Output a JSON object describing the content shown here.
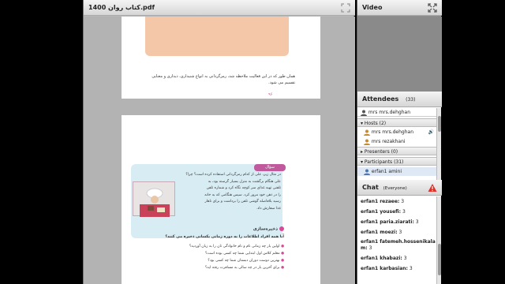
{
  "document_pod": {
    "title": "کتاب روان 1400.pdf",
    "page1": {
      "text_lines": [
        "همان طور که در این فعالیت ملاحظه شد، رمزگردانی به انواع شنیداری، دیداری و معنایی",
        "تقسیم می شود."
      ],
      "page_number": "۹۶"
    },
    "page2": {
      "question_badge": "سؤال",
      "question_lines": [
        "در مثال زیر، علی از کدام رمزگردانی استفاده کرده است؟ چرا؟",
        "علی هنگام برگشت به منزل بسیار گرسنه بود، به",
        "تلفنی تهیه غذای سر کوچه نگاه کرد و شماره تلفن",
        "را در ذهن خود مرور کرد. سپس هنگامی که به خانه",
        "رسید بلافاصله گوشی تلفن را برداشت و برای ناهار",
        "غذا سفارش داد."
      ],
      "section_heading": "ذخیره‌سازی",
      "section_question": "آیا همه افراد اطلاعات را به دوره زمانی یکسانی ذخیره می کنند؟",
      "bullets": [
        "اولین بار چه زمانی نام و نام خانوادگی تان را به زبان آوردید؟",
        "معلم کلاس اول ابتدایی شما چه کسی بوده است؟",
        "بهترین دوست دوران دبستان شما چه کسی بود؟",
        "برای آخرین بار در چه سالی به مسافرت رفته اید؟"
      ]
    }
  },
  "video_pod": {
    "title": "Video"
  },
  "attendees_pod": {
    "title": "Attendees",
    "count": "(33)",
    "host_user": "mrs mrs.dehghan",
    "hosts_group": "Hosts (2)",
    "hosts": [
      "mrs mrs.dehghan",
      "mrs rezakhani"
    ],
    "presenters_group": "Presenters (0)",
    "participants_group": "Participants (31)",
    "participants": [
      "erfan1 amini"
    ]
  },
  "chat_pod": {
    "title": "Chat",
    "scope": "(Everyone)",
    "messages": [
      {
        "sender": "erfan1 rezaee:",
        "text": "3"
      },
      {
        "sender": "erfan1 yousefi:",
        "text": "3"
      },
      {
        "sender": "erfan1 paria.ziarati:",
        "text": "3"
      },
      {
        "sender": "erfan1 moezi:",
        "text": "3"
      },
      {
        "sender": "erfan1 fatemeh.hossenikalam:",
        "text": "3"
      },
      {
        "sender": "erfan1 khabazi:",
        "text": "3"
      },
      {
        "sender": "erfan1 karbasian:",
        "text": "3"
      }
    ]
  },
  "colors": {
    "accent_pink": "#d9499a",
    "question_box": "#d7ecf3",
    "question_badge": "#c05a9c",
    "note_orange": "#f5c7a9"
  },
  "icons": [
    "fullscreen-icon",
    "user-icon",
    "collapse-arrow-icon",
    "expand-arrow-icon",
    "speaker-icon",
    "warning-icon"
  ]
}
